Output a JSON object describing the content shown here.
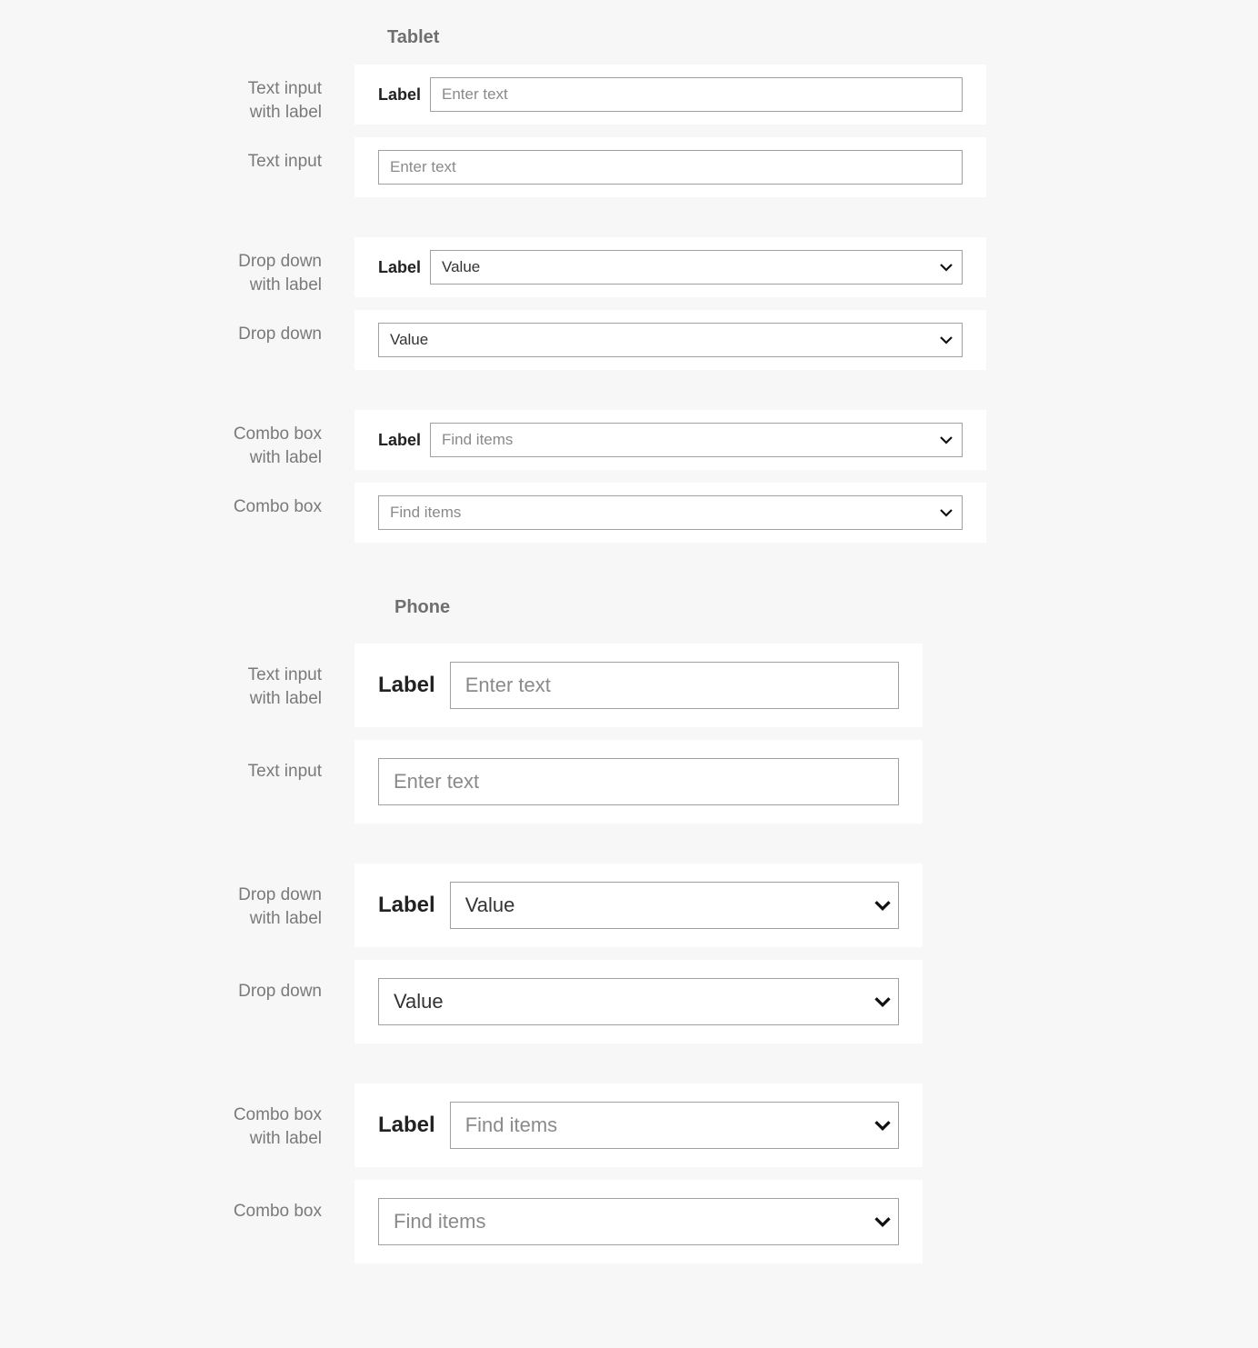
{
  "tablet": {
    "heading": "Tablet",
    "rows": {
      "text_input_with_label": {
        "desc_line1": "Text input",
        "desc_line2": "with label",
        "label": "Label",
        "placeholder": "Enter text"
      },
      "text_input": {
        "desc": "Text input",
        "placeholder": "Enter text"
      },
      "dropdown_with_label": {
        "desc_line1": "Drop down",
        "desc_line2": "with label",
        "label": "Label",
        "value": "Value"
      },
      "dropdown": {
        "desc": "Drop down",
        "value": "Value"
      },
      "combobox_with_label": {
        "desc_line1": "Combo box",
        "desc_line2": "with label",
        "label": "Label",
        "placeholder": "Find items"
      },
      "combobox": {
        "desc": "Combo box",
        "placeholder": "Find items"
      }
    }
  },
  "phone": {
    "heading": "Phone",
    "rows": {
      "text_input_with_label": {
        "desc_line1": "Text input",
        "desc_line2": "with label",
        "label": "Label",
        "placeholder": "Enter text"
      },
      "text_input": {
        "desc": "Text input",
        "placeholder": "Enter text"
      },
      "dropdown_with_label": {
        "desc_line1": "Drop down",
        "desc_line2": "with label",
        "label": "Label",
        "value": "Value"
      },
      "dropdown": {
        "desc": "Drop down",
        "value": "Value"
      },
      "combobox_with_label": {
        "desc_line1": "Combo box",
        "desc_line2": "with label",
        "label": "Label",
        "placeholder": "Find items"
      },
      "combobox": {
        "desc": "Combo box",
        "placeholder": "Find items"
      }
    }
  }
}
